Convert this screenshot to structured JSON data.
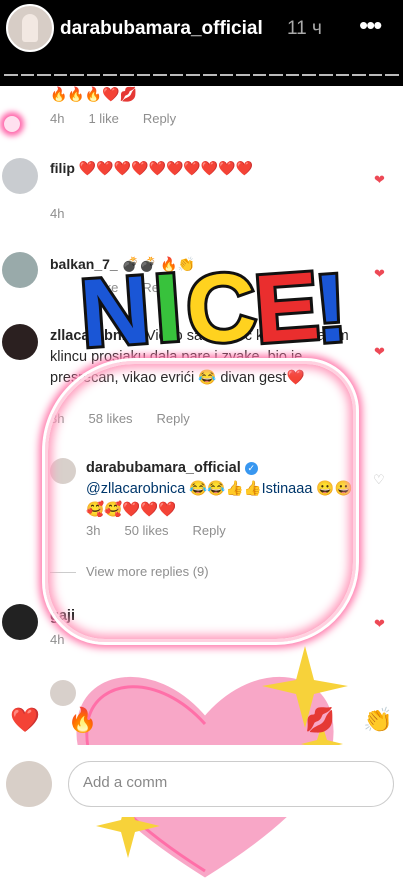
{
  "header": {
    "username": "darabubamara_official",
    "time": "11 ч",
    "more": "•••"
  },
  "comments": [
    {
      "username": "",
      "text": "🔥🔥🔥❤️💋",
      "time": "4h",
      "likes": "1 like",
      "reply": "Reply"
    },
    {
      "username": "filip",
      "text": "❤️❤️❤️❤️❤️❤️❤️❤️❤️❤️",
      "time": "4h",
      "likes": "",
      "reply": ""
    },
    {
      "username": "balkan_7_",
      "text": "💣💣 🔥👏",
      "time": "",
      "likes": "1 like",
      "reply": "Reply"
    },
    {
      "username": "zllacarobnica",
      "text": "Video sam sinoc kako si malom klincu prosjaku dala pare i zvake, bio je presrecan, vikao evrići 😂 divan gest❤️",
      "time": "3h",
      "likes": "58 likes",
      "reply": "Reply"
    },
    {
      "username": "darabubamara_official",
      "text": "@zllacarobnica 😂😂👍👍Istinaaa 😀😀🥰🥰❤️❤️❤️",
      "time": "3h",
      "likes": "50 likes",
      "reply": "Reply"
    },
    {
      "username": "gaji",
      "text": "",
      "time": "4h",
      "likes": "",
      "reply": ""
    }
  ],
  "view_more": "View more replies (9)",
  "stickers": {
    "nice": "NICE!"
  },
  "emoji_bar": [
    "❤️",
    "🔥",
    "💋",
    "👏"
  ],
  "add_comment": {
    "placeholder": "Add a comm"
  }
}
